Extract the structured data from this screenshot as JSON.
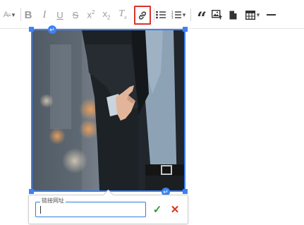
{
  "toolbar": {
    "font_size_icon": "font-size-icon",
    "bold": "B",
    "italic": "I",
    "underline": "U",
    "strikethrough": "S",
    "superscript_base": "x",
    "superscript_mark": "2",
    "subscript_base": "x",
    "subscript_mark": "2",
    "clear_format_base": "T",
    "clear_format_mark": "x",
    "quote": "“",
    "link_active": true,
    "highlight_color": "#d9342b"
  },
  "image": {
    "selected": true,
    "accent_color": "#3b82f6",
    "alt_toggle_icon": "return-arrow-icon"
  },
  "link_popup": {
    "field_label": "链接网址",
    "field_value": "",
    "save_icon": "check-icon",
    "cancel_icon": "cross-icon",
    "save_color": "#2e9b3a",
    "cancel_color": "#e0311f"
  }
}
